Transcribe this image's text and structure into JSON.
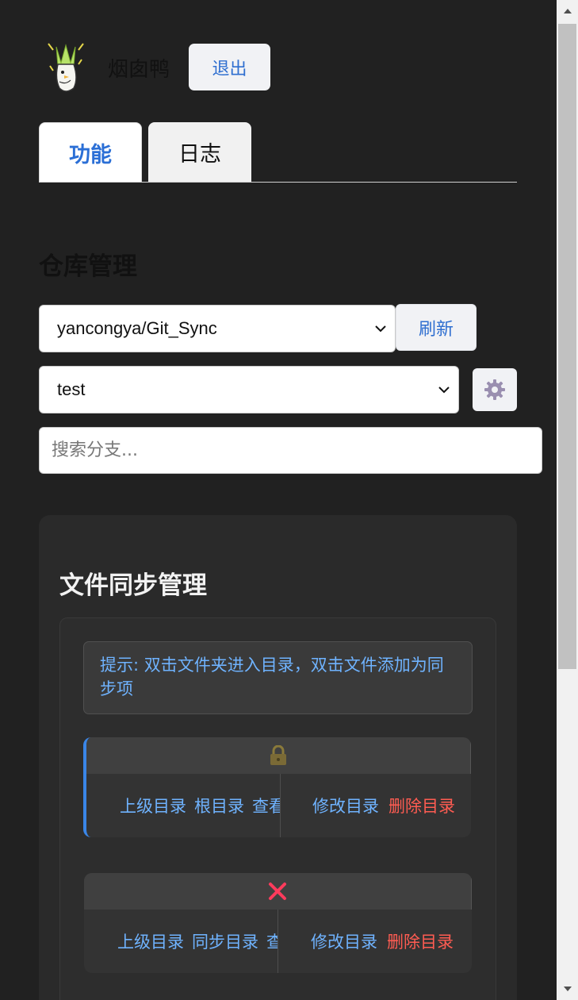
{
  "header": {
    "app_name": "烟囱鸭",
    "logout_label": "退出"
  },
  "tabs": [
    {
      "label": "功能",
      "active": true
    },
    {
      "label": "日志",
      "active": false
    }
  ],
  "repo_section": {
    "title": "仓库管理",
    "repo_value": "yancongya/Git_Sync",
    "refresh_label": "刷新",
    "branch_value": "test",
    "settings_icon": "gear-icon",
    "search_placeholder": "搜索分支..."
  },
  "file_sync": {
    "title": "文件同步管理",
    "hint": "提示: 双击文件夹进入目录，双击文件添加为同步项",
    "items": [
      {
        "icon": "lock-icon",
        "actions": [
          "上级目录",
          "根目录",
          "查看"
        ],
        "edit_label": "修改目录",
        "delete_label": "删除目录"
      },
      {
        "icon": "close-icon",
        "actions": [
          "上级目录",
          "同步目录",
          "查看"
        ],
        "edit_label": "修改目录",
        "delete_label": "删除目录"
      }
    ]
  },
  "colors": {
    "background": "#212121",
    "accent": "#2f6fd0",
    "link": "#6fb3ff",
    "danger": "#ff5c52",
    "active_border": "#3a86e8",
    "error_icon": "#ff3b5c"
  }
}
